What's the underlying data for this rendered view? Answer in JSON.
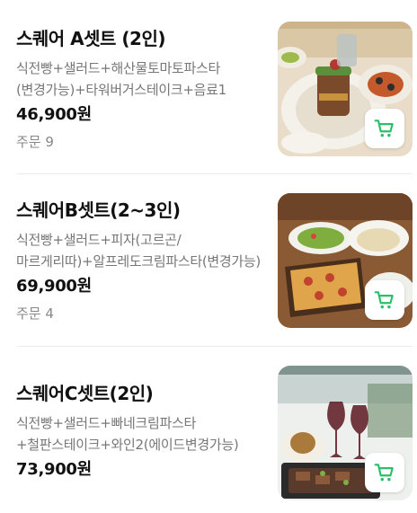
{
  "menu_items": [
    {
      "name": "스퀘어 A셋트 (2인)",
      "description": "식전빵+샐러드+해산물토마토파스타(변경가능)+타워버거스테이크+음료1",
      "price": "46,900원",
      "orders": "주문 9",
      "cart_icon": "cart-icon"
    },
    {
      "name": "스퀘어B셋트(2~3인)",
      "description": "식전빵+샐러드+피자(고르곤/마르게리따)+알프레도크림파스타(변경가능)",
      "price": "69,900원",
      "orders": "주문 4",
      "cart_icon": "cart-icon"
    },
    {
      "name": "스퀘어C셋트(2인)",
      "description": "식전빵+샐러드+빠네크림파스타+철판스테이크+와인2(에이드변경가능)",
      "price": "73,900원",
      "orders": "",
      "cart_icon": "cart-icon"
    }
  ],
  "colors": {
    "accent": "#2bbf6a",
    "text": "#111111",
    "muted": "#777777",
    "divider": "#ececec"
  }
}
